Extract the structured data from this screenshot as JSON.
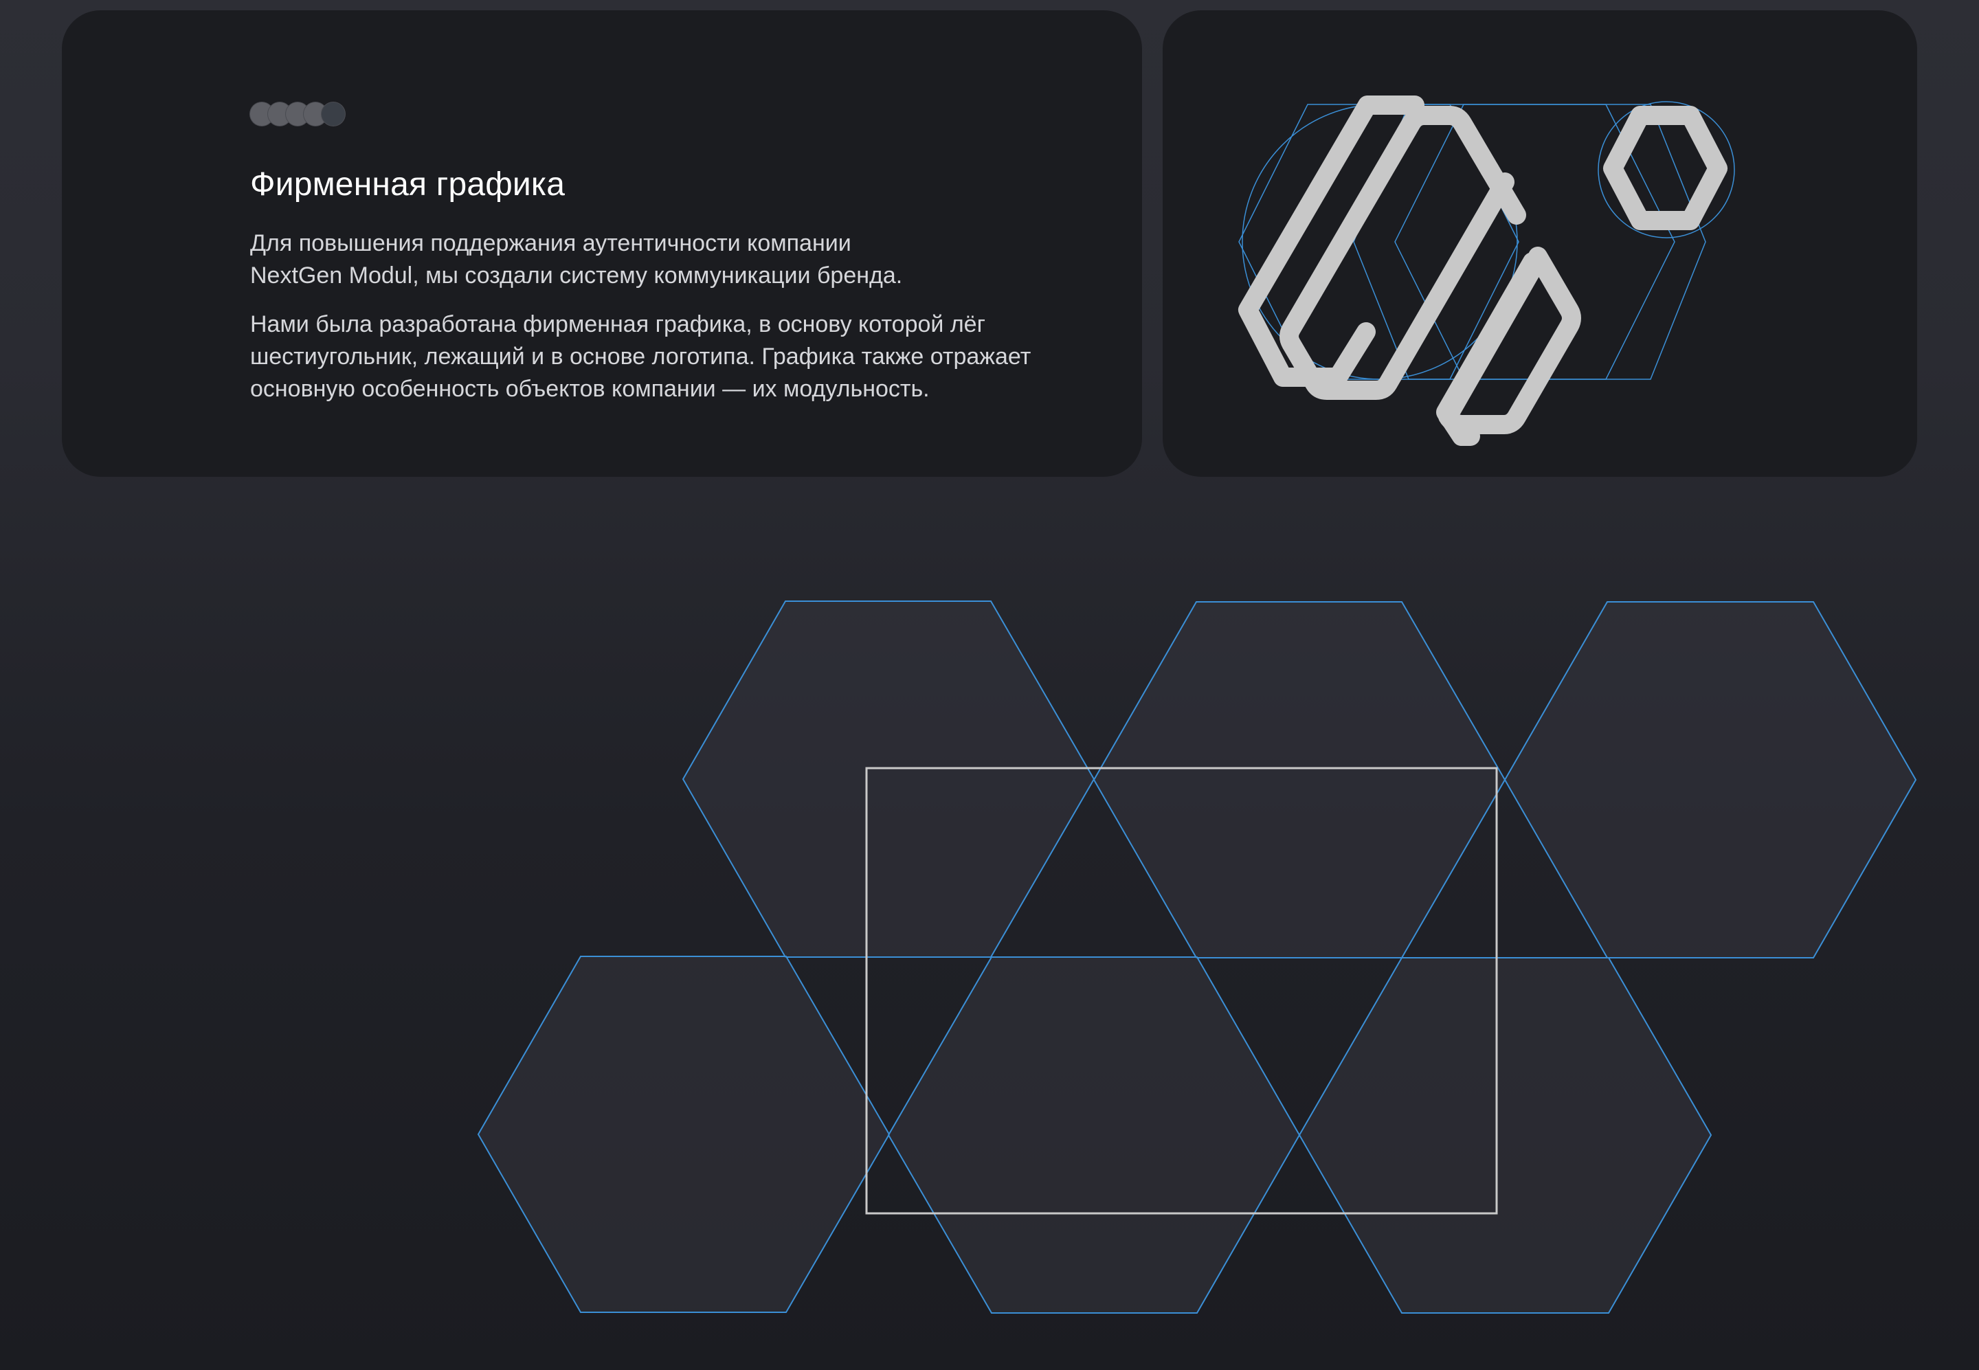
{
  "section": {
    "title": "Фирменная графика",
    "paragraph1": {
      "line1": "Для повышения поддержания аутентичности компании",
      "line2": "NextGen Modul, мы создали систему коммуникации бренда."
    },
    "paragraph2": {
      "line1": "Нами была разработана фирменная графика, в основу которой лёг",
      "line2": "шестиугольник, лежащий и в основе логотипа. Графика также отражает",
      "line3": "основную особенность объектов компании — их модульность."
    },
    "pagination_dots": 5,
    "active_dot": 5
  },
  "colors": {
    "background": "#26272e",
    "card": "#1b1c20",
    "logo_stroke": "#c8c8c8",
    "construction_lines": "#3b8fd6",
    "hex_fill": "#2f3038",
    "frame": "#c9c9c9"
  },
  "icons": {
    "logo": "hexagon-logo-construction",
    "pattern": "hexagon-grid-pattern"
  }
}
